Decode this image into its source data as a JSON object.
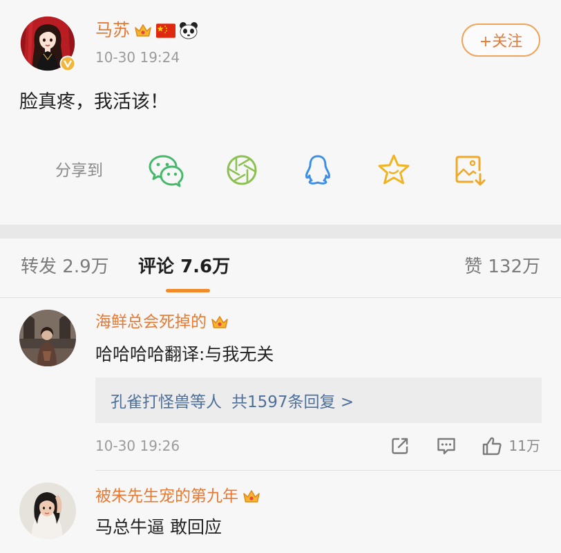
{
  "theme": {
    "accent": "#e67a34",
    "link": "#4d6f99",
    "underline": "#f08a2a",
    "follow_border": "#f0a35a"
  },
  "post": {
    "author_name": "马苏",
    "author_badges": [
      "crown-icon",
      "china-flag-icon",
      "panda-icon"
    ],
    "verified_badge": "verified-v-icon",
    "time": "10-30 19:24",
    "follow_label": "+关注",
    "text": "脸真疼，我活该！"
  },
  "share": {
    "label": "分享到",
    "targets": [
      "wechat-icon",
      "moments-icon",
      "qq-icon",
      "favorite-star-icon",
      "save-image-icon"
    ]
  },
  "tabs": [
    {
      "label": "转发",
      "count": "2.9万",
      "active": false
    },
    {
      "label": "评论",
      "count": "7.6万",
      "active": true
    },
    {
      "label": "赞",
      "count": "132万",
      "active": false
    }
  ],
  "comments": [
    {
      "author_name": "海鲜总会死掉的",
      "badge": "crown-icon",
      "text": "哈哈哈哈翻译:与我无关",
      "replies": {
        "who": "孔雀打怪兽等人",
        "total": "共1597条回复 >"
      },
      "time": "10-30 19:26",
      "actions": [
        "repost-icon",
        "comment-icon",
        "like-icon"
      ],
      "like_count": "11万"
    },
    {
      "author_name": "被朱先生宠的第九年",
      "badge": "crown-icon",
      "text": "马总牛逼 敢回应"
    }
  ]
}
